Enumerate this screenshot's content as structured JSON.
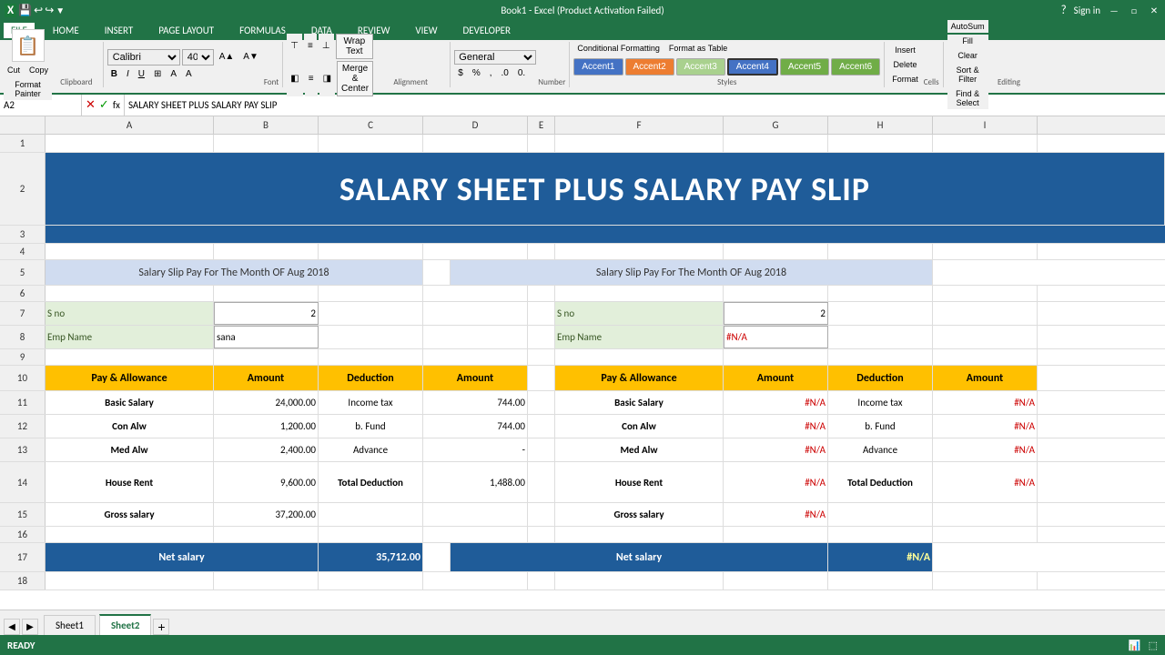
{
  "titleBar": {
    "title": "Book1 - Excel (Product Activation Failed)",
    "signIn": "Sign in"
  },
  "ribbonTabs": [
    "FILE",
    "HOME",
    "INSERT",
    "PAGE LAYOUT",
    "FORMULAS",
    "DATA",
    "REVIEW",
    "VIEW",
    "DEVELOPER"
  ],
  "activeTab": "HOME",
  "toolbar": {
    "clipboard": {
      "paste": "Paste",
      "cut": "Cut",
      "copy": "Copy",
      "formatPainter": "Format Painter",
      "label": "Clipboard"
    },
    "font": {
      "name": "Calibri",
      "size": "40",
      "bold": "B",
      "italic": "I",
      "underline": "U",
      "label": "Font"
    },
    "alignment": {
      "wrapText": "Wrap Text",
      "mergeCenter": "Merge & Center",
      "label": "Alignment"
    },
    "number": {
      "format": "General",
      "percent": "%",
      "comma": ",",
      "label": "Number"
    },
    "styles": {
      "label": "Styles",
      "conditionalFormatting": "Conditional Formatting",
      "formatAsTable": "Format as Table",
      "accent1": "Accent1",
      "accent2": "Accent2",
      "accent3": "Accent3",
      "accent4": "Accent4",
      "accent5": "Accent5",
      "accent6": "Accent6"
    },
    "cells": {
      "insert": "Insert",
      "delete": "Delete",
      "format": "Format",
      "label": "Cells"
    },
    "editing": {
      "autosum": "AutoSum",
      "fill": "Fill",
      "clear": "Clear",
      "sortFilter": "Sort & Filter",
      "findSelect": "Find & Select",
      "label": "Editing"
    }
  },
  "formulaBar": {
    "cellRef": "A2",
    "formula": "SALARY SHEET PLUS SALARY PAY SLIP"
  },
  "columns": [
    "A",
    "B",
    "C",
    "D",
    "E",
    "F",
    "G",
    "H",
    "I"
  ],
  "rows": {
    "r1": {
      "num": "1",
      "cells": {}
    },
    "r2": {
      "num": "2",
      "title": "SALARY SHEET PLUS SALARY PAY SLIP"
    },
    "r3": {
      "num": "3",
      "cells": {}
    },
    "r4": {
      "num": "4",
      "cells": {}
    },
    "r5": {
      "num": "5",
      "leftHeader": "Salary Slip Pay For The Month OF Aug 2018",
      "rightHeader": "Salary Slip Pay For The Month OF Aug 2018"
    },
    "r6": {
      "num": "6",
      "cells": {}
    },
    "r7": {
      "num": "7",
      "leftLabel": "S no",
      "leftValue": "2",
      "rightLabel": "S no",
      "rightValue": "2"
    },
    "r8": {
      "num": "8",
      "leftLabel": "Emp Name",
      "leftValue": "sana",
      "rightLabel": "Emp Name",
      "rightValue": "#N/A"
    },
    "r9": {
      "num": "9",
      "cells": {}
    },
    "r10": {
      "num": "10",
      "headers": {
        "leftPay": "Pay & Allowance",
        "leftAmt": "Amount",
        "leftDed": "Deduction",
        "leftDedAmt": "Amount",
        "rightPay": "Pay & Allowance",
        "rightAmt": "Amount",
        "rightDed": "Deduction",
        "rightDedAmt": "Amount"
      }
    },
    "r11": {
      "num": "11",
      "leftPay": "Basic Salary",
      "leftAmt": "24,000.00",
      "leftDed": "Income tax",
      "leftDedAmt": "744.00",
      "rightPay": "Basic Salary",
      "rightAmt": "#N/A",
      "rightDed": "Income tax",
      "rightDedAmt": "#N/A"
    },
    "r12": {
      "num": "12",
      "leftPay": "Con Alw",
      "leftAmt": "1,200.00",
      "leftDed": "b. Fund",
      "leftDedAmt": "744.00",
      "rightPay": "Con Alw",
      "rightAmt": "#N/A",
      "rightDed": "b. Fund",
      "rightDedAmt": "#N/A"
    },
    "r13": {
      "num": "13",
      "leftPay": "Med Alw",
      "leftAmt": "2,400.00",
      "leftDed": "Advance",
      "leftDedAmt": "-",
      "rightPay": "Med Alw",
      "rightAmt": "#N/A",
      "rightDed": "Advance",
      "rightDedAmt": "#N/A"
    },
    "r14": {
      "num": "14",
      "leftPay": "House Rent",
      "leftAmt": "9,600.00",
      "leftDed": "Total Deduction",
      "leftDedAmt": "1,488.00",
      "rightPay": "House Rent",
      "rightAmt": "#N/A",
      "rightDed": "Total Deduction",
      "rightDedAmt": "#N/A"
    },
    "r15": {
      "num": "15",
      "leftPay": "Gross salary",
      "leftAmt": "37,200.00",
      "rightPay": "Gross salary",
      "rightAmt": "#N/A"
    },
    "r16": {
      "num": "16",
      "cells": {}
    },
    "r17": {
      "num": "17",
      "leftNet": "Net salary",
      "leftNetAmt": "35,712.00",
      "rightNet": "Net salary",
      "rightNetAmt": "#N/A"
    },
    "r18": {
      "num": "18",
      "cells": {}
    }
  },
  "sheets": {
    "tabs": [
      "Sheet1",
      "Sheet2"
    ],
    "active": "Sheet2"
  },
  "status": {
    "ready": "READY"
  }
}
